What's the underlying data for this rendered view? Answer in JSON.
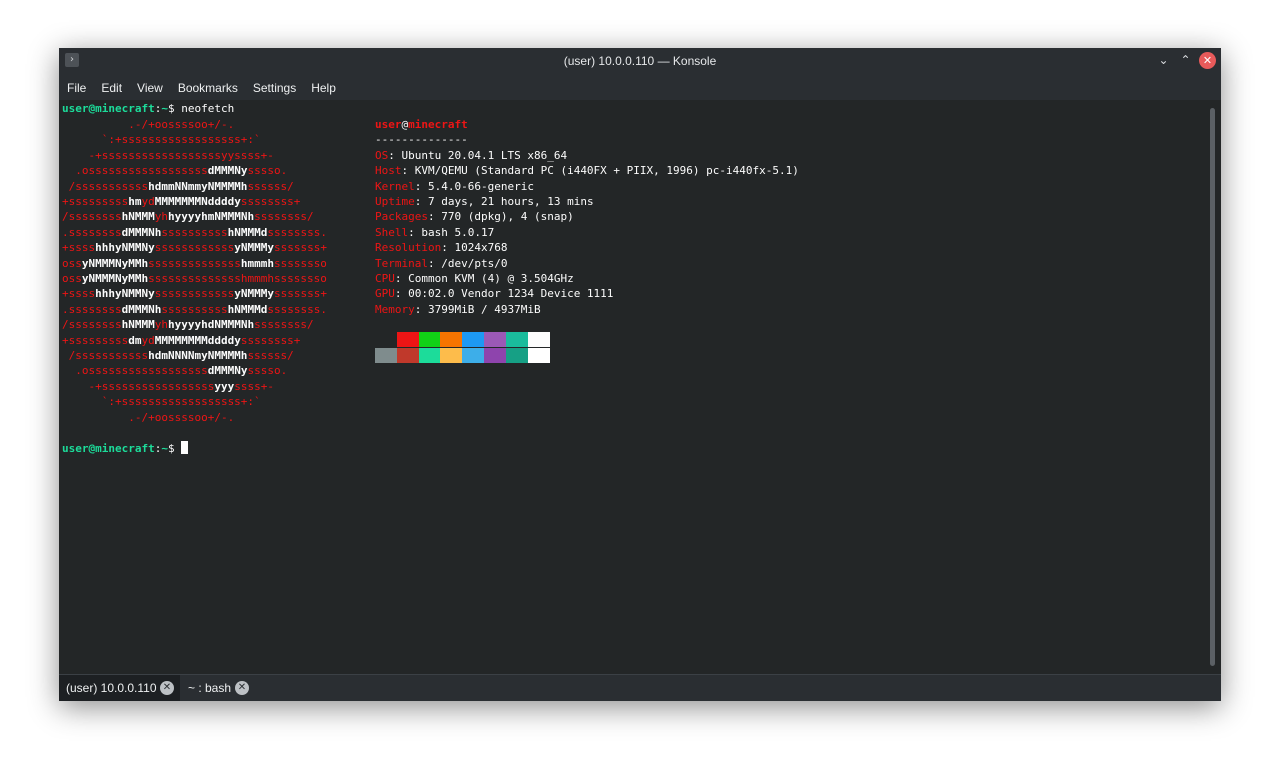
{
  "window": {
    "title": "(user) 10.0.0.110 — Konsole",
    "app_icon_glyph": "›",
    "controls": {
      "minimize_glyph": "⌄",
      "maximize_glyph": "⌃",
      "close_glyph": "✕"
    }
  },
  "menubar": [
    "File",
    "Edit",
    "View",
    "Bookmarks",
    "Settings",
    "Help"
  ],
  "terminal": {
    "prompt": {
      "user_host": "user@minecraft",
      "separator": ":",
      "path": "~",
      "symbol": "$"
    },
    "command": "neofetch",
    "logo": [
      [
        [
          "r",
          "          .-/+oossssoo+/-."
        ]
      ],
      [
        [
          "r",
          "      `:+ssssssssssssssssss+:`"
        ]
      ],
      [
        [
          "r",
          "    -+ssssssssssssssssssyyssss+-"
        ]
      ],
      [
        [
          "r",
          "  .ossssssssssssssssss"
        ],
        [
          "b",
          "dMMMNy"
        ],
        [
          "r",
          "sssso."
        ]
      ],
      [
        [
          "r",
          " /sssssssssss"
        ],
        [
          "b",
          "hdmmNNmmyNMMMMh"
        ],
        [
          "r",
          "ssssss/"
        ]
      ],
      [
        [
          "r",
          "+sssssssss"
        ],
        [
          "b",
          "hm"
        ],
        [
          "r",
          "yd"
        ],
        [
          "b",
          "MMMMMMMNddddy"
        ],
        [
          "r",
          "ssssssss+"
        ]
      ],
      [
        [
          "r",
          "/ssssssss"
        ],
        [
          "b",
          "hNMMM"
        ],
        [
          "r",
          "yh"
        ],
        [
          "b",
          "hyyyyhmNMMMNh"
        ],
        [
          "r",
          "ssssssss/"
        ]
      ],
      [
        [
          "r",
          ".ssssssss"
        ],
        [
          "b",
          "dMMMNh"
        ],
        [
          "r",
          "ssssssssss"
        ],
        [
          "b",
          "hNMMMd"
        ],
        [
          "r",
          "ssssssss."
        ]
      ],
      [
        [
          "r",
          "+ssss"
        ],
        [
          "b",
          "hhhyNMMNy"
        ],
        [
          "r",
          "ssssssssssss"
        ],
        [
          "b",
          "yNMMMy"
        ],
        [
          "r",
          "sssssss+"
        ]
      ],
      [
        [
          "r",
          "oss"
        ],
        [
          "b",
          "yNMMMNyMMh"
        ],
        [
          "r",
          "ssssssssssssss"
        ],
        [
          "b",
          "hmmmh"
        ],
        [
          "r",
          "ssssssso"
        ]
      ],
      [
        [
          "r",
          "oss"
        ],
        [
          "b",
          "yNMMMNyMMh"
        ],
        [
          "r",
          "sssssssssssssshmmmhssssssso"
        ]
      ],
      [
        [
          "r",
          "+ssss"
        ],
        [
          "b",
          "hhhyNMMNy"
        ],
        [
          "r",
          "ssssssssssss"
        ],
        [
          "b",
          "yNMMMy"
        ],
        [
          "r",
          "sssssss+"
        ]
      ],
      [
        [
          "r",
          ".ssssssss"
        ],
        [
          "b",
          "dMMMNh"
        ],
        [
          "r",
          "ssssssssss"
        ],
        [
          "b",
          "hNMMMd"
        ],
        [
          "r",
          "ssssssss."
        ]
      ],
      [
        [
          "r",
          "/ssssssss"
        ],
        [
          "b",
          "hNMMM"
        ],
        [
          "r",
          "yh"
        ],
        [
          "b",
          "hyyyyhdNMMMNh"
        ],
        [
          "r",
          "ssssssss/"
        ]
      ],
      [
        [
          "r",
          "+sssssssss"
        ],
        [
          "b",
          "dm"
        ],
        [
          "r",
          "yd"
        ],
        [
          "b",
          "MMMMMMMMddddy"
        ],
        [
          "r",
          "ssssssss+"
        ]
      ],
      [
        [
          "r",
          " /sssssssssss"
        ],
        [
          "b",
          "hdmNNNNmyNMMMMh"
        ],
        [
          "r",
          "ssssss/"
        ]
      ],
      [
        [
          "r",
          "  .ossssssssssssssssss"
        ],
        [
          "b",
          "dMMMNy"
        ],
        [
          "r",
          "sssso."
        ]
      ],
      [
        [
          "r",
          "    -+sssssssssssssssss"
        ],
        [
          "b",
          "yyy"
        ],
        [
          "r",
          "ssss+-"
        ]
      ],
      [
        [
          "r",
          "      `:+ssssssssssssssssss+:`"
        ]
      ],
      [
        [
          "r",
          "          .-/+oossssoo+/-."
        ]
      ]
    ],
    "info": {
      "user": "user",
      "at": "@",
      "host": "minecraft",
      "divider": "--------------",
      "fields": [
        {
          "key": "OS",
          "value": "Ubuntu 20.04.1 LTS x86_64"
        },
        {
          "key": "Host",
          "value": "KVM/QEMU (Standard PC (i440FX + PIIX, 1996) pc-i440fx-5.1)"
        },
        {
          "key": "Kernel",
          "value": "5.4.0-66-generic"
        },
        {
          "key": "Uptime",
          "value": "7 days, 21 hours, 13 mins"
        },
        {
          "key": "Packages",
          "value": "770 (dpkg), 4 (snap)"
        },
        {
          "key": "Shell",
          "value": "bash 5.0.17"
        },
        {
          "key": "Resolution",
          "value": "1024x768"
        },
        {
          "key": "Terminal",
          "value": "/dev/pts/0"
        },
        {
          "key": "CPU",
          "value": "Common KVM (4) @ 3.504GHz"
        },
        {
          "key": "GPU",
          "value": "00:02.0 Vendor 1234 Device 1111"
        },
        {
          "key": "Memory",
          "value": "3799MiB / 4937MiB"
        }
      ],
      "colors_row1": [
        "#232627",
        "#ed1515",
        "#11d116",
        "#f67400",
        "#1d99f3",
        "#9b59b6",
        "#1abc9c",
        "#fcfcfc"
      ],
      "colors_row2": [
        "#7f8c8d",
        "#c0392b",
        "#1cdc9a",
        "#fdbc4b",
        "#3daee9",
        "#8e44ad",
        "#16a085",
        "#ffffff"
      ]
    }
  },
  "tabs": [
    {
      "label": "(user) 10.0.0.110",
      "active": true,
      "close_glyph": "✕"
    },
    {
      "label": "~ : bash",
      "active": false,
      "close_glyph": "✕"
    }
  ]
}
